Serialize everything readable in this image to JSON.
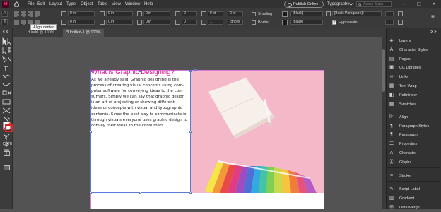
{
  "app": {
    "logo_text": "Id"
  },
  "menu": [
    "File",
    "Edit",
    "Layout",
    "Type",
    "Object",
    "Table",
    "View",
    "Window",
    "Help"
  ],
  "publish_label": "Publish Online",
  "workspace_label": "Typography",
  "search_placeholder": "Adobe Stock",
  "control": {
    "x_values": [
      "0 in",
      "0 in"
    ],
    "w_values": [
      "0 in",
      "0 in"
    ],
    "kerning": "0",
    "tracking": "0",
    "pt_value": "0 pt",
    "pt_value2": "0 pt",
    "pt_value3": "0 pt",
    "ignore_label": "Ignore",
    "shading_label": "Shading",
    "border_label": "Border",
    "black_label_1": "[Black]",
    "black_label_2": "[Black]",
    "para_style": "[Basic Paragraph]+",
    "hyphenate_label": "Hyphenate",
    "col_values": [
      "0 in",
      "0 in",
      "0 in",
      "0 in"
    ],
    "col_count": "1"
  },
  "tooltip": "Align center",
  "tabs": [
    "d.indd @ 100%",
    "*Untitled-1 @ 100%"
  ],
  "document": {
    "heading": "What is Graphic Designing?",
    "body_lines": [
      "As we already said, Graphic designing is the",
      "process of creating visual concepts using com-",
      "puter software for conveying ideas to the con-",
      "sumers. Simply we can say that graphic design",
      "is an art of projecting or showing different",
      "ideas or concepts with visual and typographic",
      "contents. Since the best way to communicate is",
      "through visuals everyone uses graphic design to",
      "convey their ideas to the consumers."
    ]
  },
  "panels": [
    {
      "label": "Layers",
      "icon": "layers-icon"
    },
    {
      "label": "Character Styles",
      "icon": "character-styles-icon"
    },
    {
      "label": "Pages",
      "icon": "pages-icon"
    },
    {
      "label": "CC Libraries",
      "icon": "cc-libraries-icon"
    },
    {
      "label": "Links",
      "icon": "links-icon"
    },
    {
      "label": "Text Wrap",
      "icon": "text-wrap-icon"
    },
    {
      "label": "Pathfinder",
      "icon": "pathfinder-icon"
    },
    {
      "label": "Swatches",
      "icon": "swatches-icon"
    },
    {
      "label": "Align",
      "icon": "align-icon"
    },
    {
      "label": "Paragraph Styles",
      "icon": "paragraph-styles-icon"
    },
    {
      "label": "Paragraph",
      "icon": "paragraph-icon"
    },
    {
      "label": "Properties",
      "icon": "properties-icon"
    },
    {
      "label": "Character",
      "icon": "character-icon"
    },
    {
      "label": "Glyphs",
      "icon": "glyphs-icon"
    },
    {
      "label": "Stroke",
      "icon": "stroke-icon"
    },
    {
      "label": "Script Label",
      "icon": "script-label-icon"
    },
    {
      "label": "Gradient",
      "icon": "gradient-icon"
    },
    {
      "label": "Data Merge",
      "icon": "data-merge-icon"
    }
  ],
  "colors": {
    "accent": "#d6138f",
    "frame": "#5c7bd8",
    "bleed": "#d97ad6",
    "photo_bg": "#f4b8c9"
  }
}
